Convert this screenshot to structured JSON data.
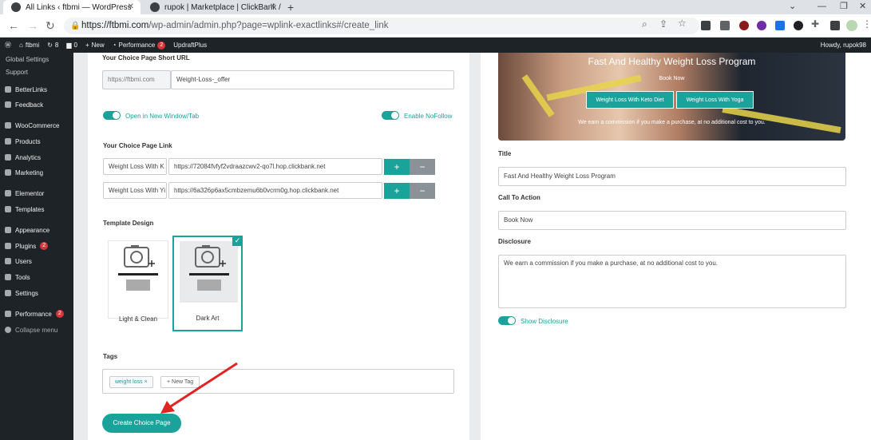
{
  "browser": {
    "tabs": [
      {
        "title": "All Links ‹ ftbmi — WordPress"
      },
      {
        "title": "rupok | Marketplace | ClickBank /"
      }
    ],
    "url_host": "https://ftbmi.com",
    "url_path": "/wp-admin/admin.php?page=wplink-exactlinks#/create_link"
  },
  "adminbar": {
    "site": "ftbmi",
    "updates": "8",
    "comments": "0",
    "new": "New",
    "performance": "Performance",
    "performance_badge": "2",
    "updraft": "UpdraftPlus",
    "howdy": "Howdy, rupok98"
  },
  "sidebar": {
    "items": [
      {
        "label": "Global Settings"
      },
      {
        "label": "Support"
      },
      {
        "label": "BetterLinks"
      },
      {
        "label": "Feedback"
      },
      {
        "label": "WooCommerce"
      },
      {
        "label": "Products"
      },
      {
        "label": "Analytics"
      },
      {
        "label": "Marketing"
      },
      {
        "label": "Elementor"
      },
      {
        "label": "Templates"
      },
      {
        "label": "Appearance"
      },
      {
        "label": "Plugins",
        "badge": "2"
      },
      {
        "label": "Users"
      },
      {
        "label": "Tools"
      },
      {
        "label": "Settings"
      },
      {
        "label": "Performance",
        "badge": "2"
      },
      {
        "label": "Collapse menu"
      }
    ]
  },
  "form": {
    "short_url_label": "Your Choice Page Short URL",
    "short_url_prefix": "https://ftbmi.com",
    "short_url_value": "Weight-Loss-_offer",
    "open_new_window": "Open in New Window/Tab",
    "enable_nofollow": "Enable NoFollow",
    "choice_link_label": "Your Choice Page Link",
    "links": [
      {
        "name": "Weight Loss With K",
        "url": "https://72084fvfyf2vdraazcwv2-qo7l.hop.clickbank.net"
      },
      {
        "name": "Weight Loss With Yi",
        "url": "https://6a326p6ax5cmbzemu6b0vcrm0g.hop.clickbank.net"
      }
    ],
    "plus": "+",
    "minus": "−",
    "template_label": "Template Design",
    "templates": [
      {
        "name": "Light & Clean"
      },
      {
        "name": "Dark Art"
      }
    ],
    "tags_label": "Tags",
    "tag": "weight loss",
    "tag_remove": "×",
    "new_tag": "+ New Tag",
    "create_button": "Create Choice Page"
  },
  "preview": {
    "title": "Fast And Healthy Weight Loss Program",
    "cta": "Book Now",
    "buttons": [
      "Weight Loss With Keto Diet",
      "Weight Loss With Yoga"
    ],
    "disclosure": "We earn a commission if you make a purchase, at no additional cost to you."
  },
  "right_form": {
    "title_label": "Title",
    "title_value": "Fast And Healthy Weight Loss Program",
    "cta_label": "Call To Action",
    "cta_value": "Book Now",
    "disclosure_label": "Disclosure",
    "disclosure_value": "We earn a commission if you make a purchase, at no additional cost to you.",
    "show_disclosure": "Show Disclosure"
  },
  "colors": {
    "accent": "#1aa39a",
    "wp_dark": "#1d2327"
  }
}
